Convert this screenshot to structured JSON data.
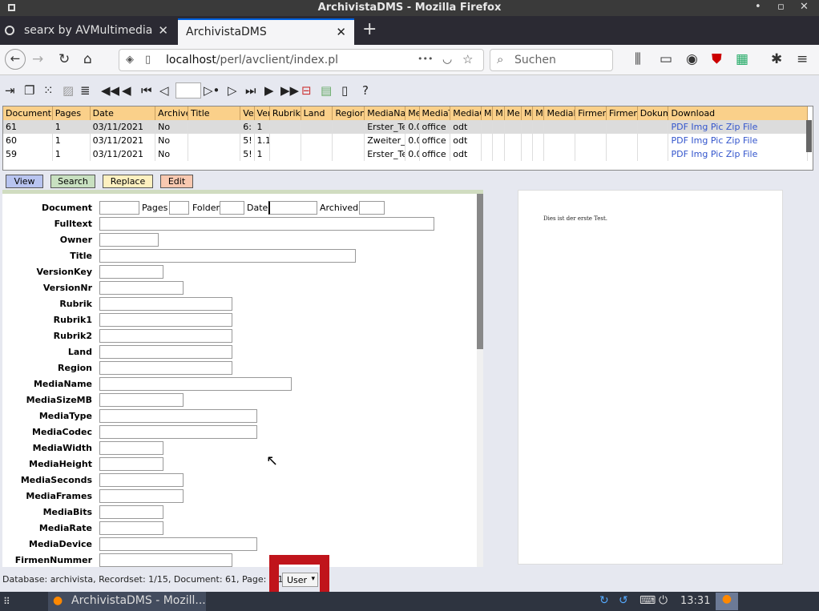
{
  "window": {
    "title": "ArchivistaDMS - Mozilla Firefox",
    "min": "•",
    "max": "▫",
    "close": "✕"
  },
  "tabs": [
    {
      "label": "searx by AVMultimedia",
      "close": "✕"
    },
    {
      "label": "ArchivistaDMS",
      "close": "✕"
    }
  ],
  "newtab": "+",
  "nav": {
    "url_host": "localhost",
    "url_path": "/perl/avclient/index.pl",
    "dots": "•••",
    "search_placeholder": "Suchen"
  },
  "grid": {
    "headers": [
      "Document",
      "Pages",
      "Date",
      "Archive",
      "Title",
      "Ve",
      "Ver",
      "Rubrik",
      "Land",
      "Region",
      "MediaNa",
      "Me",
      "MediaT",
      "MediaC",
      "M",
      "M",
      "Me",
      "M",
      "M",
      "MediaI",
      "Firmen",
      "Firmen",
      "Dokum",
      "Download"
    ],
    "rows": [
      {
        "doc": "61",
        "pages": "1",
        "date": "03/11/2021",
        "arch": "No",
        "title": "",
        "ve": "6:",
        "ver": "1",
        "medianame": "Erster_Te",
        "me": "0.0",
        "mediatype": "office",
        "mediacodec": "odt",
        "pdf": "PDF",
        "img": "Img",
        "pic": "Pic",
        "zip": "Zip",
        "file": "File"
      },
      {
        "doc": "60",
        "pages": "1",
        "date": "03/11/2021",
        "arch": "No",
        "title": "",
        "ve": "5!",
        "ver": "1.1",
        "medianame": "Zweiter_",
        "me": "0.0",
        "mediatype": "office",
        "mediacodec": "odt",
        "pdf": "PDF",
        "img": "Img",
        "pic": "Pic",
        "zip": "Zip",
        "file": "File"
      },
      {
        "doc": "59",
        "pages": "1",
        "date": "03/11/2021",
        "arch": "No",
        "title": "",
        "ve": "5!",
        "ver": "1",
        "medianame": "Erster_Te",
        "me": "0.0",
        "mediatype": "office",
        "mediacodec": "odt",
        "pdf": "PDF",
        "img": "Img",
        "pic": "Pic",
        "zip": "Zip",
        "file": "File"
      }
    ]
  },
  "modes": {
    "view": "View",
    "search": "Search",
    "replace": "Replace",
    "edit": "Edit"
  },
  "form": {
    "document": "Document",
    "pages": "Pages",
    "folder": "Folder",
    "date": "Date",
    "archived": "Archived",
    "fields": [
      "Fulltext",
      "Owner",
      "Title",
      "VersionKey",
      "VersionNr",
      "Rubrik",
      "Rubrik1",
      "Rubrik2",
      "Land",
      "Region",
      "MediaName",
      "MediaSizeMB",
      "MediaType",
      "MediaCodec",
      "MediaWidth",
      "MediaHeight",
      "MediaSeconds",
      "MediaFrames",
      "MediaBits",
      "MediaRate",
      "MediaDevice",
      "FirmenNummer"
    ]
  },
  "preview": {
    "text": "Dies ist der erste Test."
  },
  "status": {
    "text": "Database: archivista, Recordset: 1/15, Document: 61, Page: 1/1, For",
    "user": "User"
  },
  "taskbar": {
    "window": "ArchivistaDMS - Mozill...",
    "clock": "13:31"
  },
  "colors": {
    "grid_header": "#fad08a",
    "view": "#b8c4f0",
    "search": "#c8e0c0",
    "replace": "#fdf0c0",
    "edit": "#f8c8b0",
    "highlight": "#c0141b"
  }
}
